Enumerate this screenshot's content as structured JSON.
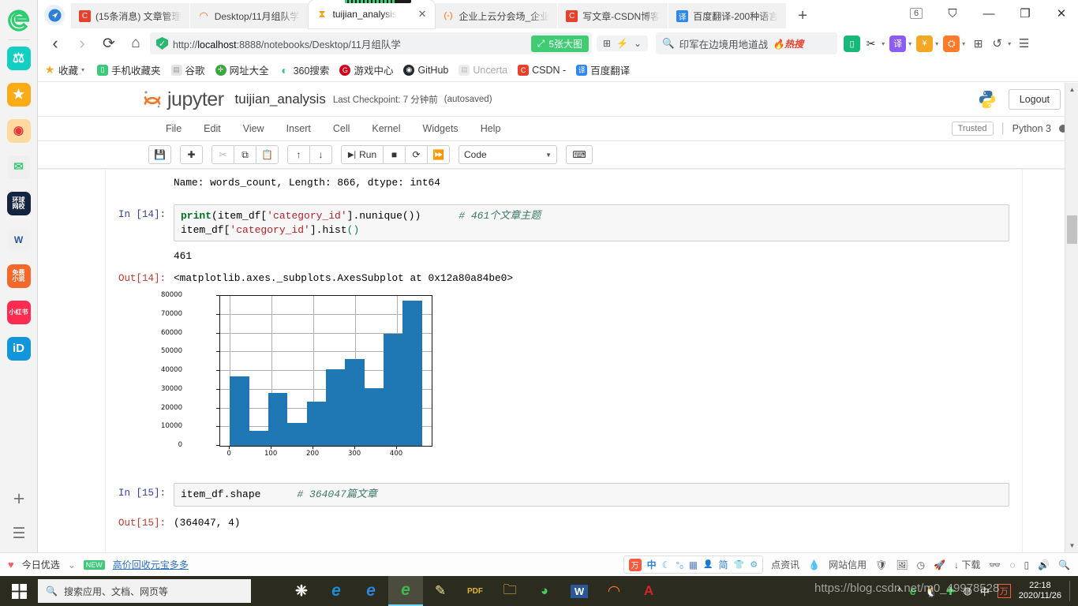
{
  "browser": {
    "tabs": [
      {
        "favicon": "csdn-icon",
        "favicon_color": "#e8402a",
        "favicon_text": "C",
        "label": "(15条消息) 文章管理",
        "active": false
      },
      {
        "favicon": "jupyter-icon",
        "favicon_color": "#ffffff",
        "favicon_text": "◠",
        "label": "Desktop/11月组队学",
        "active": false
      },
      {
        "favicon": "hourglass-icon",
        "favicon_color": "#ffffff",
        "favicon_text": "⧗",
        "label": "tuijian_analysis",
        "active": true
      },
      {
        "favicon": "aliyun-icon",
        "favicon_color": "#ffffff",
        "favicon_text": "(-)",
        "label": "企业上云分会场_企业",
        "active": false
      },
      {
        "favicon": "csdn-icon",
        "favicon_color": "#e8402a",
        "favicon_text": "C",
        "label": "写文章-CSDN博客",
        "active": false
      },
      {
        "favicon": "baidu-fanyi-icon",
        "favicon_color": "#2e86f0",
        "favicon_text": "译",
        "label": "百度翻译-200种语言",
        "active": false
      }
    ],
    "new_tab_label": "+",
    "window_count": "6",
    "window_controls": {
      "restore_session": "⛉",
      "minimize": "—",
      "maximize": "❐",
      "close": "✕"
    },
    "nav": {
      "back": "‹",
      "forward": "›",
      "reload": "⟳",
      "home": "⌂"
    },
    "address": {
      "shield_icon": "security-shield-icon",
      "url_prefix": "http://",
      "url_host": "localhost",
      "url_rest": ":8888/notebooks/Desktop/11月组队学",
      "bigpic_label": "5张大图",
      "bigpic_icon": "expand-icon"
    },
    "toolbar_mini": {
      "grid_icon": "⊞",
      "bolt_icon": "⚡",
      "chevron_icon": "⌄"
    },
    "search": {
      "icon": "search-icon",
      "value": "印军在边境用地道战",
      "hot_label": "热搜",
      "hot_icon": "🔥"
    },
    "extensions": [
      {
        "name": "note-extension",
        "glyph": "▯",
        "color": "#17b978"
      },
      {
        "name": "scissors-extension",
        "glyph": "✂",
        "color": "#ffffff"
      },
      {
        "name": "translate-extension",
        "glyph": "译",
        "color": "#8b5cf6"
      },
      {
        "name": "shield-extension",
        "glyph": "¥",
        "color": "#f5a623"
      },
      {
        "name": "game-extension",
        "glyph": "🎮",
        "color": "#ff7a29"
      },
      {
        "name": "apps-extension",
        "glyph": "⊞",
        "color": "#555555"
      },
      {
        "name": "undo-extension",
        "glyph": "↺",
        "color": "#555555"
      },
      {
        "name": "menu-extension",
        "glyph": "☰",
        "color": "#555555"
      }
    ],
    "bookmarks": [
      {
        "label": "收藏",
        "icon": "star-icon",
        "color": "#f5a623",
        "glyph": "★",
        "faded": false
      },
      {
        "label": "手机收藏夹",
        "icon": "phone-icon",
        "color": "#3ec97a",
        "glyph": "▯",
        "faded": false
      },
      {
        "label": "谷歌",
        "icon": "page-icon",
        "color": "#d8d8d8",
        "glyph": "▤",
        "faded": false
      },
      {
        "label": "网址大全",
        "icon": "plus-circle-icon",
        "color": "#3ea63e",
        "glyph": "✛",
        "faded": false
      },
      {
        "label": "360搜索",
        "icon": "so360-icon",
        "color": "#2ecb70",
        "glyph": "O",
        "faded": false
      },
      {
        "label": "游戏中心",
        "icon": "game-icon",
        "color": "#d0021b",
        "glyph": "G",
        "faded": false
      },
      {
        "label": "GitHub",
        "icon": "github-icon",
        "color": "#24292e",
        "glyph": "◉",
        "faded": false
      },
      {
        "label": "Uncerta",
        "icon": "page-icon",
        "color": "#d8d8d8",
        "glyph": "▤",
        "faded": true
      },
      {
        "label": "CSDN -",
        "icon": "csdn-icon",
        "color": "#e8402a",
        "glyph": "C",
        "faded": false
      },
      {
        "label": "百度翻译",
        "icon": "baidu-fanyi-icon",
        "color": "#2e86f0",
        "glyph": "译",
        "faded": false
      }
    ]
  },
  "jupyter": {
    "brand": "jupyter",
    "notebook_name": "tuijian_analysis",
    "checkpoint": "Last Checkpoint: 7 分钟前",
    "autosaved": "(autosaved)",
    "logout_label": "Logout",
    "menus": [
      "File",
      "Edit",
      "View",
      "Insert",
      "Cell",
      "Kernel",
      "Widgets",
      "Help"
    ],
    "trusted_label": "Trusted",
    "kernel_name": "Python 3",
    "toolbar": {
      "save": "💾",
      "insert_below": "✚",
      "cut": "✂",
      "copy": "⧉",
      "paste": "📋",
      "move_up": "↑",
      "move_down": "↓",
      "run_label": "Run",
      "run_icon": "▶|",
      "interrupt": "■",
      "restart": "⟳",
      "restart_run_all": "⏩",
      "cell_type": "Code",
      "command_palette": "⌨"
    }
  },
  "notebook": {
    "top_output": "Name: words_count, Length: 866, dtype: int64",
    "cells": [
      {
        "prompt_in": "In  [14]:",
        "code_line1_a": "print",
        "code_line1_b": "(item_df[",
        "code_line1_c": "'category_id'",
        "code_line1_d": "].nunique",
        "code_line1_e": "())",
        "code_line1_comment": "# 461个文章主题",
        "code_line2_a": "item_df[",
        "code_line2_b": "'category_id'",
        "code_line2_c": "].hist",
        "code_line2_d": "()",
        "stdout": "461",
        "prompt_out": "Out[14]:",
        "out_repr": "<matplotlib.axes._subplots.AxesSubplot at 0x12a80a84be0>"
      },
      {
        "prompt_in": "In  [15]:",
        "code": "item_df.shape",
        "comment": "# 364047篇文章",
        "prompt_out": "Out[15]:",
        "out_repr": "(364047, 4)"
      }
    ]
  },
  "chart_data": {
    "type": "bar",
    "title": "",
    "xlabel": "",
    "ylabel": "",
    "note": "pandas Series.hist() histogram of item_df['category_id'] with 10 bins",
    "xlim": [
      -23,
      483
    ],
    "ylim": [
      0,
      80000
    ],
    "xticks": [
      0,
      100,
      200,
      300,
      400
    ],
    "yticks": [
      0,
      10000,
      20000,
      30000,
      40000,
      50000,
      60000,
      70000,
      80000
    ],
    "grid": true,
    "bar_color": "#1f77b4",
    "bin_edges": [
      0,
      46,
      92,
      138,
      184,
      230,
      276,
      322,
      368,
      414,
      460
    ],
    "values": [
      37000,
      8000,
      28200,
      12300,
      23600,
      40800,
      46400,
      30800,
      59900,
      77600
    ]
  },
  "statusbar": {
    "left_icon": "heart-icon",
    "left_label": "今日优选",
    "chevron": "⌄",
    "new_badge": "NEW",
    "promo_link": "高价回收元宝多多",
    "ime": {
      "logo": "万",
      "items": [
        "中",
        "☾",
        "°ₒ",
        "▦",
        "👤",
        "简",
        "👕",
        "⚙"
      ]
    },
    "right_items": [
      {
        "name": "news-label",
        "label": "点资讯"
      },
      {
        "name": "site-credit-label",
        "label": "网站信用",
        "icon": "water-drop-icon"
      },
      {
        "name": "shield-icon",
        "label": "🛡"
      },
      {
        "name": "image-icon",
        "label": "🖼"
      },
      {
        "name": "speed-icon",
        "label": "◷"
      },
      {
        "name": "rocket-icon",
        "label": "🚀"
      },
      {
        "name": "download-label",
        "label": "下载"
      },
      {
        "name": "glasses-icon",
        "label": "👓"
      },
      {
        "name": "shape-icon",
        "label": "◌"
      },
      {
        "name": "book-icon",
        "label": "▯"
      },
      {
        "name": "sound-icon",
        "label": "🔊"
      },
      {
        "name": "search-icon",
        "label": "🔍"
      }
    ]
  },
  "taskbar": {
    "start_icon": "windows-start-icon",
    "search_placeholder": "搜索应用、文档、网页等",
    "apps": [
      {
        "name": "taskbar-app-sogou",
        "glyph": "S",
        "color": "#ffffff",
        "active": false
      },
      {
        "name": "taskbar-app-ie",
        "glyph": "e",
        "color": "#1a8fd6",
        "active": false
      },
      {
        "name": "taskbar-app-edge",
        "glyph": "e",
        "color": "#2b87dd",
        "active": false
      },
      {
        "name": "taskbar-app-360browser",
        "glyph": "e",
        "color": "#3dbb4c",
        "active": true
      },
      {
        "name": "taskbar-app-editor",
        "glyph": "✎",
        "color": "#f0e39a",
        "active": false
      },
      {
        "name": "taskbar-app-pdf",
        "glyph": "PDF",
        "color": "#e0b62e",
        "active": false
      },
      {
        "name": "taskbar-app-explorer",
        "glyph": "📁",
        "color": "#f5c244",
        "active": false
      },
      {
        "name": "taskbar-app-wechat",
        "glyph": "◕",
        "color": "#4aca5a",
        "active": false
      },
      {
        "name": "taskbar-app-word",
        "glyph": "W",
        "color": "#2b579a",
        "active": false
      },
      {
        "name": "taskbar-app-jupyter",
        "glyph": "◠",
        "color": "#f37726",
        "active": false
      },
      {
        "name": "taskbar-app-acrobat",
        "glyph": "A",
        "color": "#d8232a",
        "active": false
      }
    ],
    "tray": [
      "^",
      "e",
      "🐧",
      "✚",
      "🔅",
      "中",
      "万",
      "🗨"
    ],
    "clock_time": "22:18",
    "clock_date": "2020/11/26"
  },
  "watermark": "https://blog.csdn.net/m0_49978528"
}
